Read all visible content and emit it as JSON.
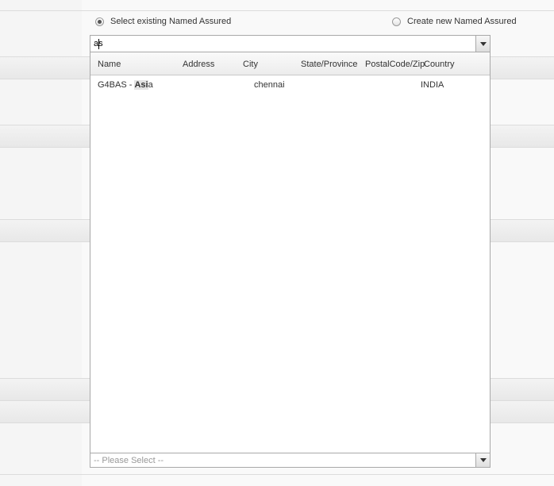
{
  "named_assured": {
    "radio_existing_label": "Select existing Named Assured",
    "radio_existing_checked": true,
    "radio_new_label": "Create new Named Assured",
    "radio_new_checked": false
  },
  "search": {
    "value": "as"
  },
  "results": {
    "columns": [
      "Name",
      "Address",
      "City",
      "State/Province",
      "PostalCode/Zip",
      "Country"
    ],
    "rows": [
      {
        "name_prefix": "G4BAS - ",
        "name_match": "Asi",
        "name_suffix": "a",
        "address": "",
        "city": "chennai",
        "state": "",
        "postal": "",
        "country": "INDIA"
      }
    ]
  },
  "secondary_select": {
    "placeholder": "-- Please Select --"
  }
}
